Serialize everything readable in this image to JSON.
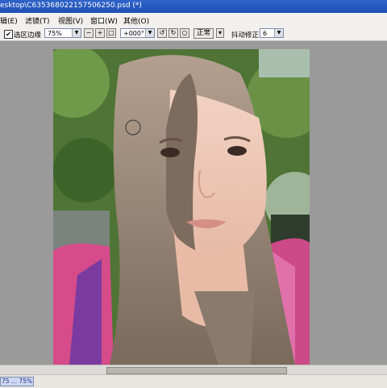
{
  "window": {
    "title": "esktop\\C635368022157506250.psd (*)"
  },
  "menu": [
    {
      "label": "辑(E)"
    },
    {
      "label": "滤镜(T)"
    },
    {
      "label": "视图(V)"
    },
    {
      "label": "窗口(W)"
    },
    {
      "label": "其他(O)"
    }
  ],
  "toolbar": {
    "antialias_checked": true,
    "antialias_label": "选区边缘",
    "zoom_value": "75%",
    "angle_value": "+000°",
    "normal_button": "正常",
    "stabilizer_label": "抖动修正",
    "stabilizer_value": "6"
  },
  "status": {
    "zoom_text": "75 ... 75%"
  },
  "colors": {
    "titlebar": "#2456c0",
    "toolbar_bg": "#f1f0ee",
    "workspace": "#9a9a9a"
  },
  "icons": [
    "zoom-out-icon",
    "zoom-in-icon",
    "zoom-fit-icon",
    "rotate-left-icon",
    "rotate-right-icon",
    "rotate-reset-icon",
    "brush-cursor-icon"
  ]
}
